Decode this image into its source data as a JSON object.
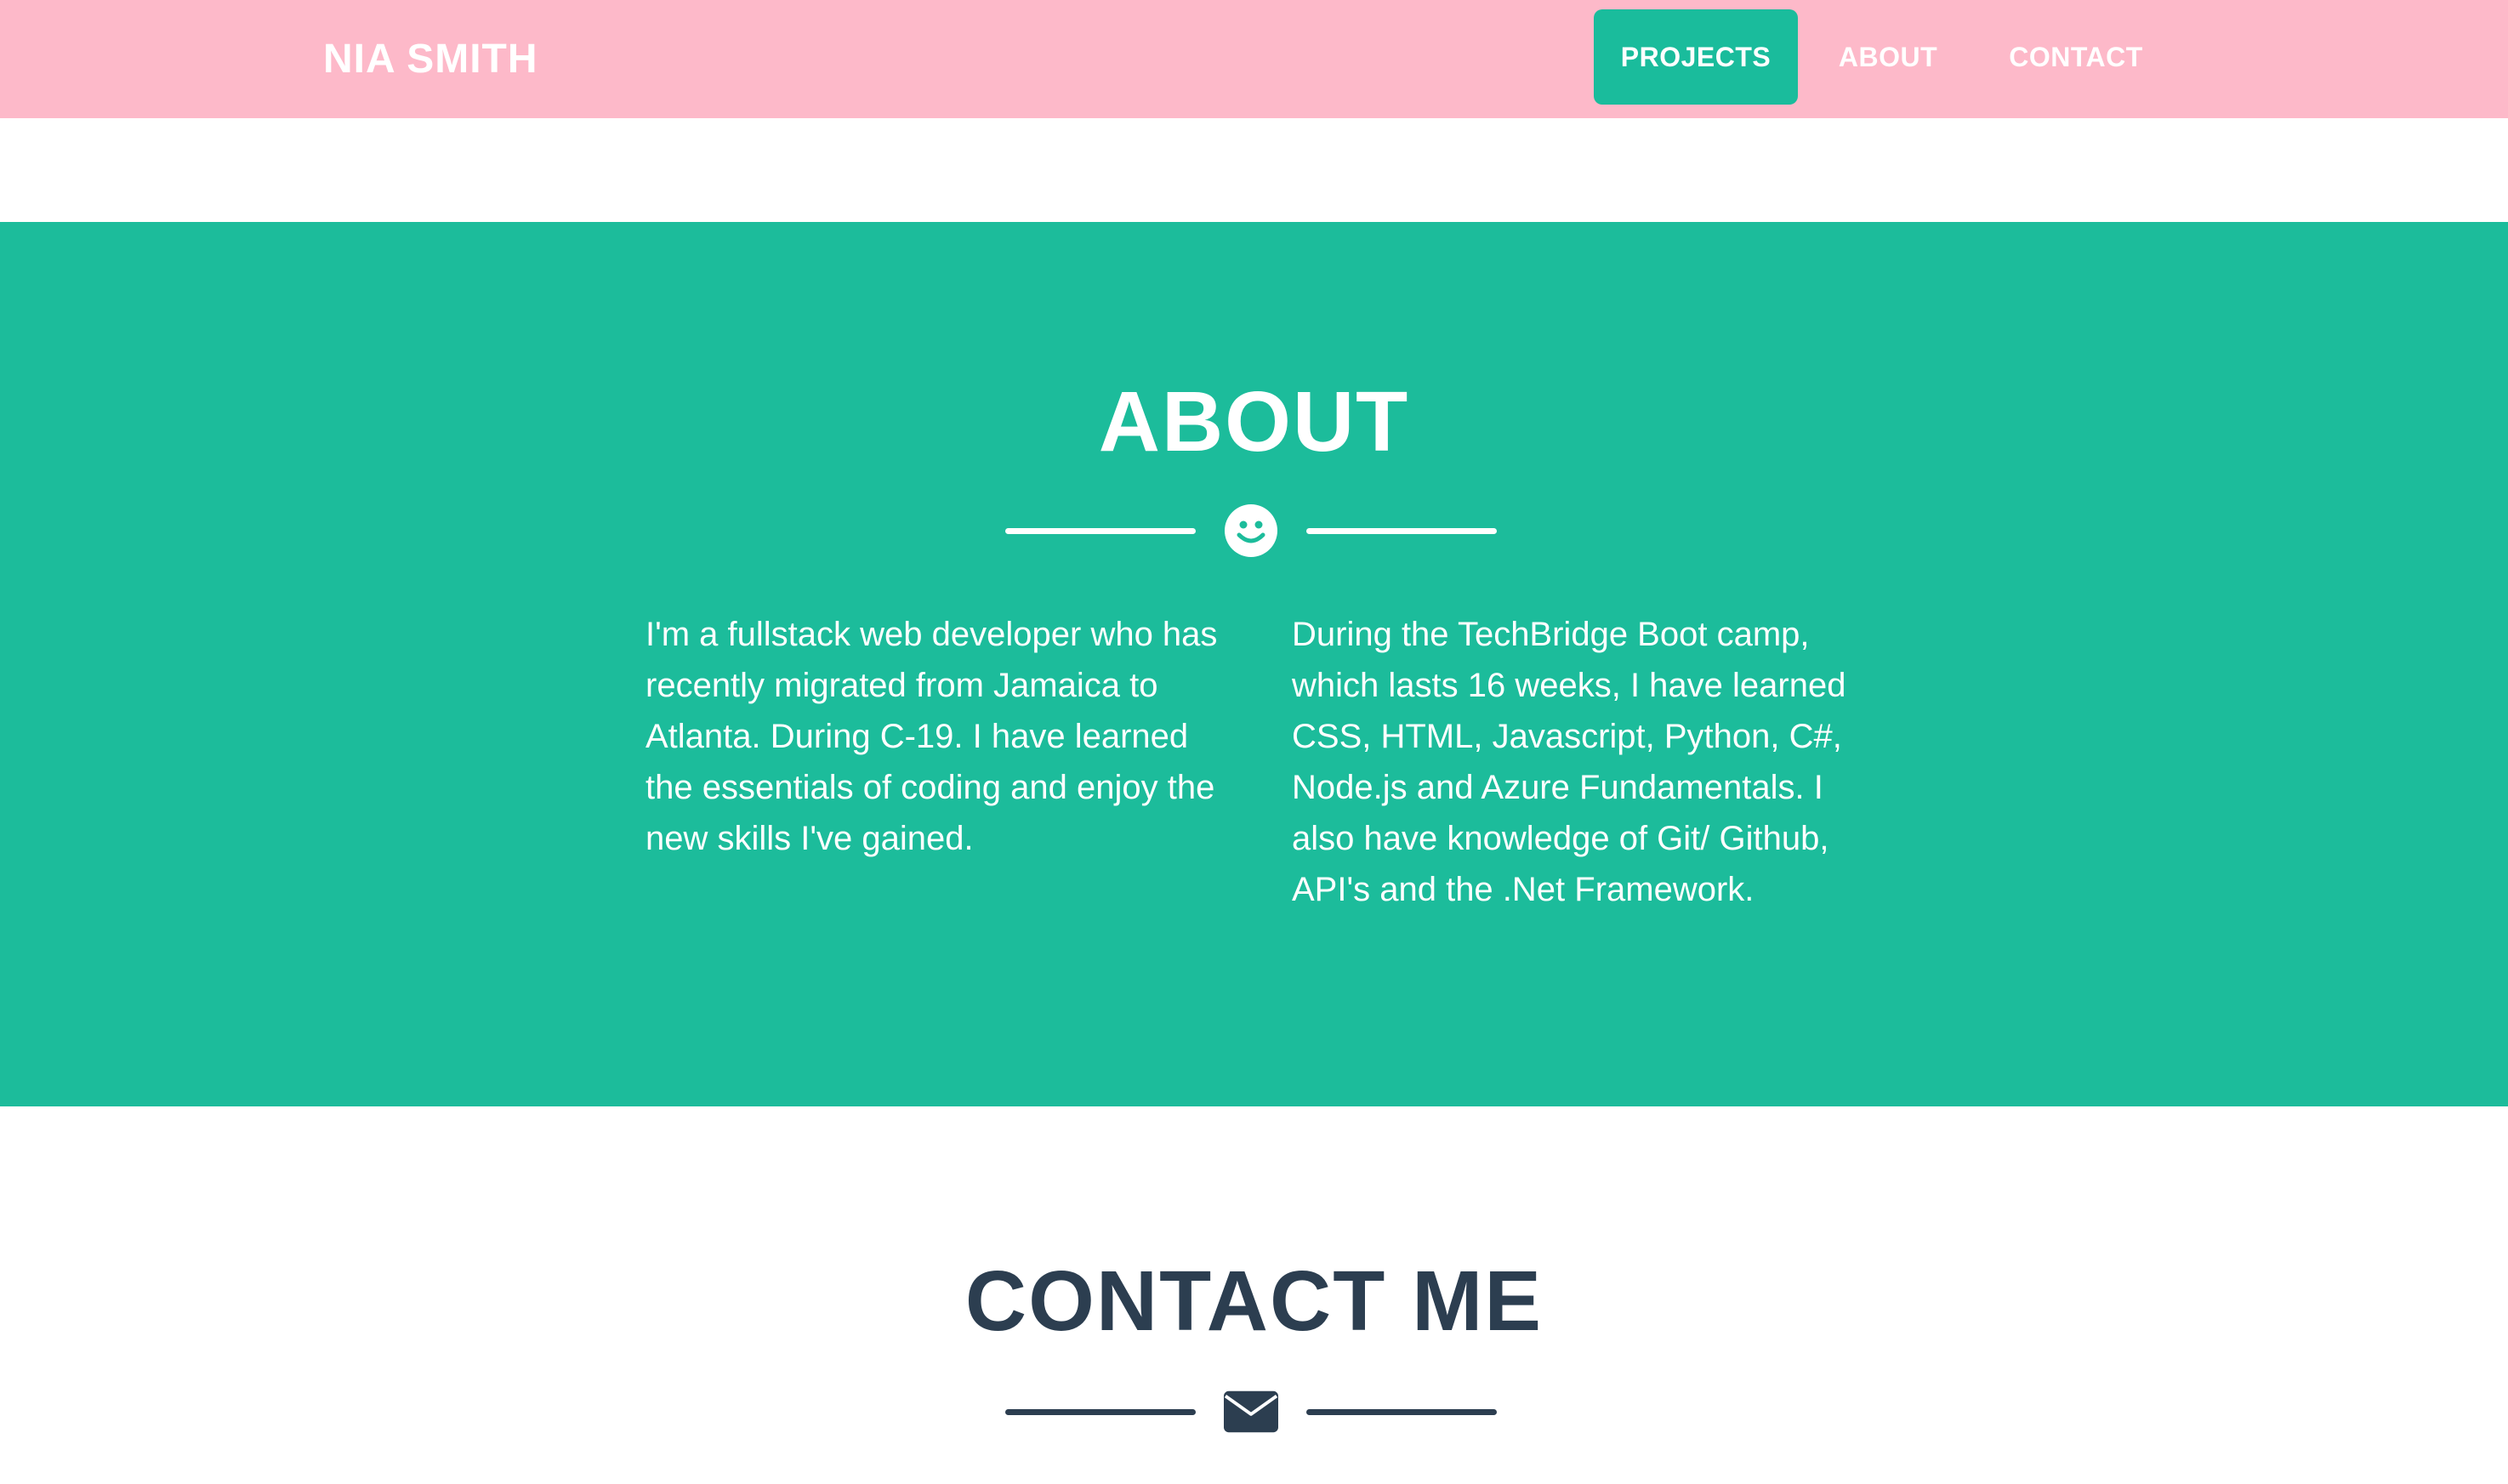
{
  "navbar": {
    "brand": "NIA SMITH",
    "items": [
      {
        "label": "PROJECTS",
        "active": true
      },
      {
        "label": "ABOUT",
        "active": false
      },
      {
        "label": "CONTACT",
        "active": false
      }
    ]
  },
  "about": {
    "title": "ABOUT",
    "icon": "smile-icon",
    "paragraphs": [
      "I'm a fullstack web developer who has recently migrated from Jamaica to Atlanta. During C-19. I have learned the essentials of coding and enjoy the new skills I've gained.",
      "During the TechBridge Boot camp, which lasts 16 weeks, I have learned CSS, HTML, Javascript, Python, C#, Node.js and Azure Fundamentals. I also have knowledge of Git/ Github, API's and the .Net Framework."
    ]
  },
  "contact": {
    "title": "CONTACT ME",
    "icon": "envelope-icon"
  },
  "colors": {
    "navbar_bg": "#fdb9c9",
    "accent": "#1abc9c",
    "about_bg": "#1cbc9b",
    "dark_text": "#2c3e50",
    "white": "#ffffff"
  }
}
